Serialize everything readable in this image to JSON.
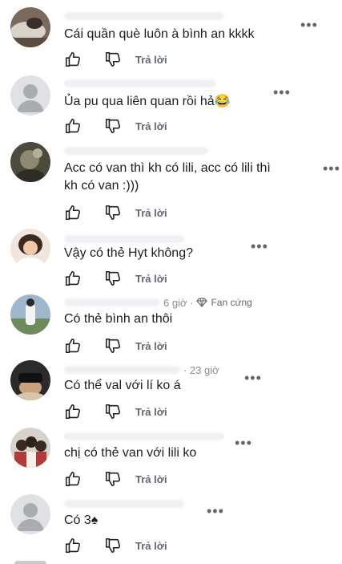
{
  "comments": [
    {
      "text": "Cái quần què luôn à bình an kkkk",
      "meta": "",
      "badge": "",
      "reply": "Trả lời"
    },
    {
      "text": "Ủa pu qua liên quan rồi hả😂",
      "meta": "",
      "badge": "",
      "reply": "Trả lời"
    },
    {
      "text": "Acc có van thì kh có lili, acc có lili thì\nkh có van :)))",
      "meta": "",
      "badge": "",
      "reply": "Trả lời"
    },
    {
      "text": "Vậy có thẻ Hyt không?",
      "meta": "",
      "badge": "",
      "reply": "Trả lời"
    },
    {
      "text": "Có thẻ bình an thôi",
      "meta": "6 giờ ·",
      "badge": "Fan cứng",
      "reply": "Trả lời"
    },
    {
      "text": "Có thể val với lí ko á",
      "meta": "· 23 giờ",
      "badge": "",
      "reply": "Trả lời"
    },
    {
      "text": "chị có thẻ van với lili ko",
      "meta": "",
      "badge": "",
      "reply": "Trả lời"
    },
    {
      "text": "Có 3♠",
      "meta": "",
      "badge": "",
      "reply": "Trả lời"
    }
  ],
  "icons": {
    "like": "thumbs-up-icon",
    "dislike": "thumbs-down-icon",
    "more": "more-options-icon",
    "badge": "diamond-icon"
  },
  "colors": {
    "text": "#1c1e21",
    "secondary": "#606770",
    "meta": "#8a8d91"
  }
}
